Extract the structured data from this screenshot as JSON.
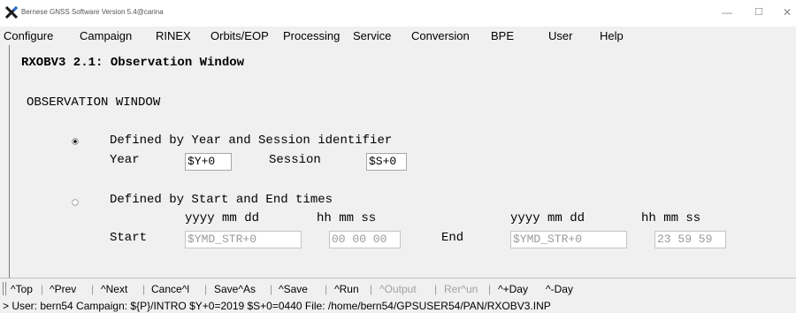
{
  "window": {
    "title": "Bernese GNSS Software Version 5.4@carina",
    "minimize": "—",
    "maximize": "☐",
    "close": "✕"
  },
  "menu": [
    "Configure",
    "Campaign",
    "RINEX",
    "Orbits/EOP",
    "Processing",
    "Service",
    "Conversion",
    "BPE",
    "User",
    "Help"
  ],
  "panel": {
    "heading": "RXOBV3 2.1: Observation Window",
    "section": "OBSERVATION WINDOW",
    "option1": {
      "label": "Defined by Year and Session identifier",
      "selected": true,
      "year_label": "Year",
      "year_value": "$Y+0",
      "session_label": "Session",
      "session_value": "$S+0"
    },
    "option2": {
      "label": "Defined by Start and End times",
      "selected": false,
      "date_format": "yyyy mm dd",
      "time_format": "hh mm ss",
      "start_label": "Start",
      "start_date": "$YMD_STR+0",
      "start_time": "00 00 00",
      "end_label": "End",
      "end_date": "$YMD_STR+0",
      "end_time": "23 59 59"
    }
  },
  "toolbar": [
    {
      "label": "^Top",
      "enabled": true
    },
    {
      "label": "^Prev",
      "enabled": true
    },
    {
      "label": "^Next",
      "enabled": true
    },
    {
      "label": "Cance^l",
      "enabled": true
    },
    {
      "label": "Save^As",
      "enabled": true
    },
    {
      "label": "^Save",
      "enabled": true
    },
    {
      "label": "^Run",
      "enabled": true
    },
    {
      "label": "^Output",
      "enabled": false
    },
    {
      "label": "Rer^un",
      "enabled": false
    },
    {
      "label": "^+Day",
      "enabled": true
    },
    {
      "label": "^-Day",
      "enabled": true
    }
  ],
  "status": "> User: bern54  Campaign: ${P}/INTRO  $Y+0=2019  $S+0=0440  File: /home/bern54/GPSUSER54/PAN/RXOBV3.INP"
}
